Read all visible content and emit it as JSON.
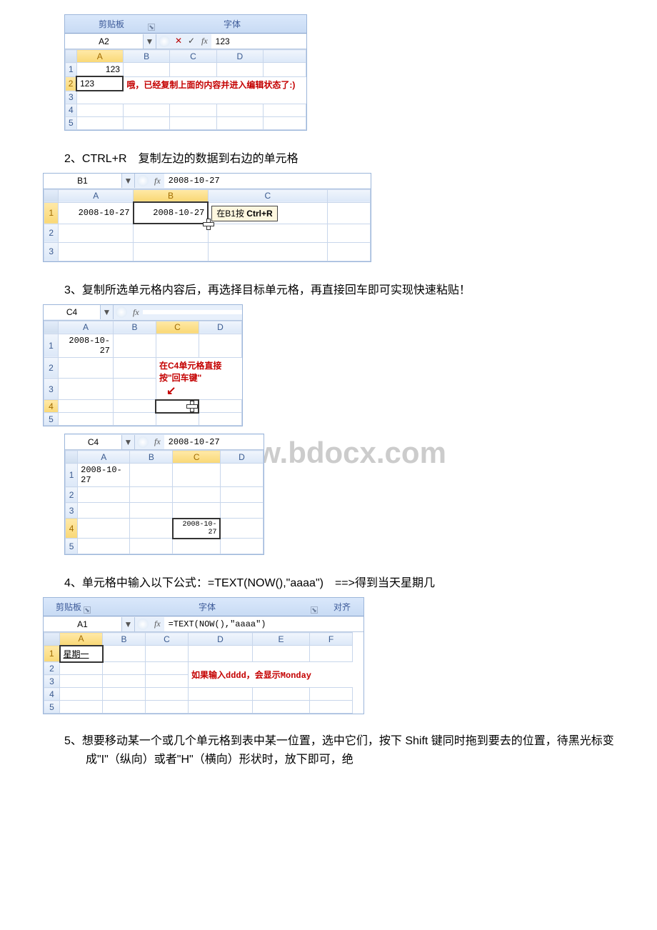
{
  "watermark": "www.bdocx.com",
  "snippet1": {
    "ribbon": {
      "clipboard": "剪贴板",
      "font": "字体"
    },
    "namebox": "A2",
    "formula_value": "123",
    "cols": [
      "A",
      "B",
      "C",
      "D"
    ],
    "rows": [
      "1",
      "2",
      "3",
      "4",
      "5"
    ],
    "a1": "123",
    "a2": "123",
    "annot": "哦，已经复制上面的内容并进入编辑状态了:)"
  },
  "text2": "2、CTRL+R　复制左边的数据到右边的单元格",
  "snippet2": {
    "namebox": "B1",
    "formula_value": "2008-10-27",
    "cols": [
      "A",
      "B",
      "C"
    ],
    "rows": [
      "1",
      "2",
      "3"
    ],
    "a1": "2008-10-27",
    "b1": "2008-10-27",
    "annot": "在B1按 Ctrl+R"
  },
  "text3": "3、复制所选单元格内容后，再选择目标单元格，再直接回车即可实现快速粘贴！",
  "snippet3a": {
    "namebox": "C4",
    "formula_value": "",
    "cols": [
      "A",
      "B",
      "C",
      "D"
    ],
    "rows": [
      "1",
      "2",
      "3",
      "4",
      "5"
    ],
    "a1": "2008-10-27",
    "annot_line1": "在C4单元格直接",
    "annot_line2": "按\"回车键\""
  },
  "snippet3b": {
    "namebox": "C4",
    "formula_value": "2008-10-27",
    "cols": [
      "A",
      "B",
      "C",
      "D"
    ],
    "rows": [
      "1",
      "2",
      "3",
      "4",
      "5"
    ],
    "a1": "2008-10-27",
    "c4": "2008-10-27"
  },
  "text4": "4、单元格中输入以下公式：=TEXT(NOW(),\"aaaa\")　==>得到当天星期几",
  "snippet4": {
    "ribbon": {
      "clipboard": "剪贴板",
      "font": "字体",
      "align": "对齐"
    },
    "namebox": "A1",
    "formula_value": "=TEXT(NOW(),\"aaaa\")",
    "cols": [
      "A",
      "B",
      "C",
      "D",
      "E",
      "F"
    ],
    "rows": [
      "1",
      "2",
      "3",
      "4",
      "5"
    ],
    "a1": "星期一",
    "annot": "如果输入dddd，会显示Monday"
  },
  "text5": "5、想要移动某一个或几个单元格到表中某一位置，选中它们，按下 Shift 键同时拖到要去的位置，待黑光标变成\"I\"（纵向）或者\"H\"（横向）形状时，放下即可，绝"
}
